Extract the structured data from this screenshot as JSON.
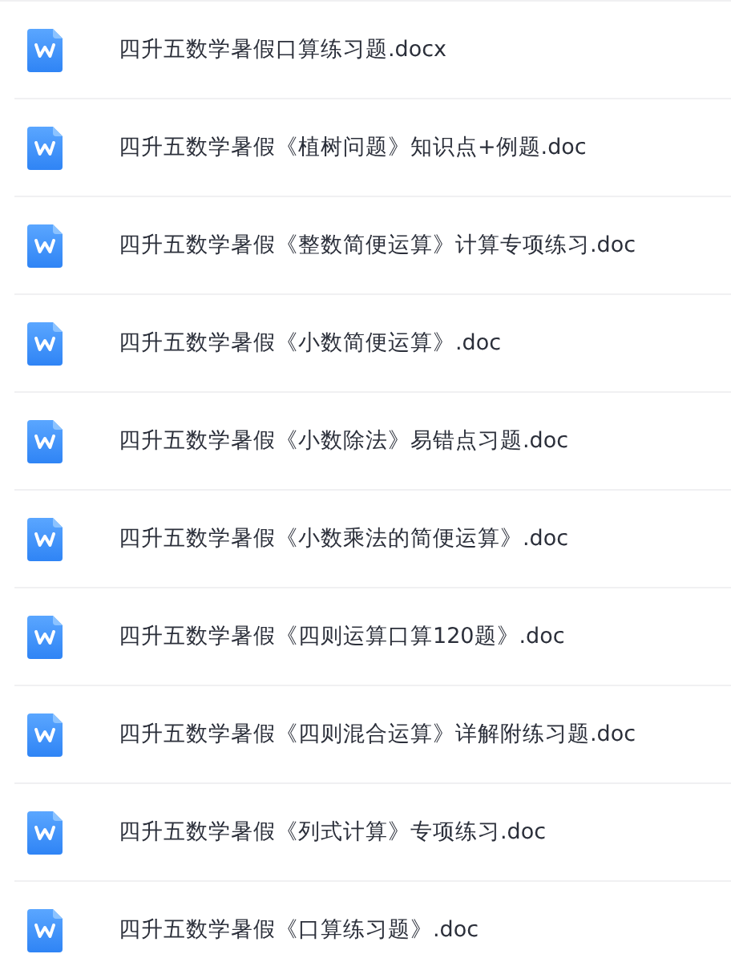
{
  "files": [
    {
      "name": "四升五数学暑假口算练习题.docx"
    },
    {
      "name": "四升五数学暑假《植树问题》知识点+例题.doc"
    },
    {
      "name": "四升五数学暑假《整数简便运算》计算专项练习.doc"
    },
    {
      "name": "四升五数学暑假《小数简便运算》.doc"
    },
    {
      "name": "四升五数学暑假《小数除法》易错点习题.doc"
    },
    {
      "name": "四升五数学暑假《小数乘法的简便运算》.doc"
    },
    {
      "name": "四升五数学暑假《四则运算口算120题》.doc"
    },
    {
      "name": "四升五数学暑假《四则混合运算》详解附练习题.doc"
    },
    {
      "name": "四升五数学暑假《列式计算》专项练习.doc"
    },
    {
      "name": "四升五数学暑假《口算练习题》.doc"
    }
  ]
}
